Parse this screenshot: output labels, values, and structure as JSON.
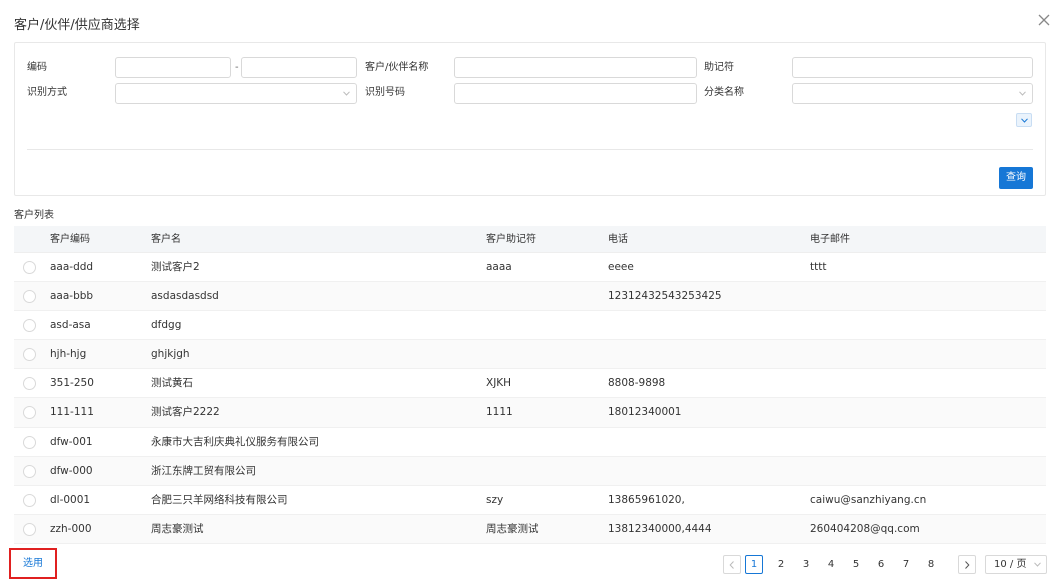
{
  "dialog": {
    "title": "客户/伙伴/供应商选择"
  },
  "filters": {
    "code_label": "编码",
    "code_separator": "-",
    "name_label": "客户/伙伴名称",
    "mnemonic_label": "助记符",
    "id_method_label": "识别方式",
    "id_number_label": "识别号码",
    "category_label": "分类名称",
    "query_label": "查询"
  },
  "list": {
    "title": "客户列表",
    "columns": [
      "客户编码",
      "客户名",
      "客户助记符",
      "电话",
      "电子邮件"
    ],
    "rows": [
      {
        "code": "aaa-ddd",
        "name": "测试客户2",
        "mnemonic": "aaaa",
        "phone": "eeee",
        "email": "tttt"
      },
      {
        "code": "aaa-bbb",
        "name": "asdasdasdsd",
        "mnemonic": "",
        "phone": "12312432543253425",
        "email": ""
      },
      {
        "code": "asd-asa",
        "name": "dfdgg",
        "mnemonic": "",
        "phone": "",
        "email": ""
      },
      {
        "code": "hjh-hjg",
        "name": "ghjkjgh",
        "mnemonic": "",
        "phone": "",
        "email": ""
      },
      {
        "code": "351-250",
        "name": "测试黄石",
        "mnemonic": "XJKH",
        "phone": "8808-9898",
        "email": ""
      },
      {
        "code": "111-111",
        "name": "测试客户2222",
        "mnemonic": "1111",
        "phone": "18012340001",
        "email": ""
      },
      {
        "code": "dfw-001",
        "name": "永康市大吉利庆典礼仪服务有限公司",
        "mnemonic": "",
        "phone": "",
        "email": ""
      },
      {
        "code": "dfw-000",
        "name": "浙江东牌工贸有限公司",
        "mnemonic": "",
        "phone": "",
        "email": ""
      },
      {
        "code": "dl-0001",
        "name": "合肥三只羊网络科技有限公司",
        "mnemonic": "szy",
        "phone": "13865961020,",
        "email": "caiwu@sanzhiyang.cn"
      },
      {
        "code": "zzh-000",
        "name": "周志豪测试",
        "mnemonic": "周志豪测试",
        "phone": "13812340000,4444",
        "email": "260404208@qq.com"
      }
    ]
  },
  "footer": {
    "use_label": "选用",
    "pages": [
      "1",
      "2",
      "3",
      "4",
      "5",
      "6",
      "7",
      "8"
    ],
    "current_page": "1",
    "page_size": "10 / 页"
  },
  "colors": {
    "primary": "#1677d6",
    "highlight_border": "#e02020"
  },
  "icons": [
    "close-icon",
    "chevron-down-icon",
    "chevron-left-icon",
    "chevron-right-icon"
  ]
}
